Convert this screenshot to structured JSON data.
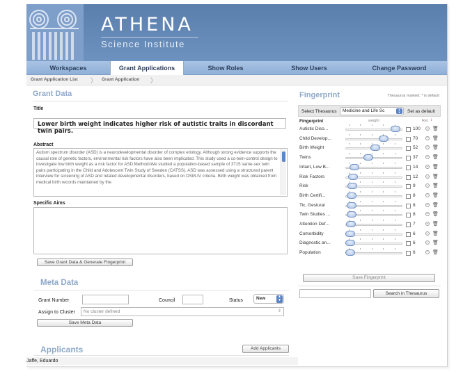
{
  "brand": {
    "title": "ATHENA",
    "subtitle": "Science Institute"
  },
  "nav": {
    "items": [
      {
        "label": "Workspaces"
      },
      {
        "label": "Grant Applications"
      },
      {
        "label": "Show Roles"
      },
      {
        "label": "Show Users"
      },
      {
        "label": "Change Password"
      }
    ]
  },
  "breadcrumb": {
    "items": [
      {
        "label": "Grant Application List"
      },
      {
        "label": "Grant Application"
      }
    ]
  },
  "grant": {
    "section_title": "Grant Data",
    "title_label": "Title",
    "title_value": "Lower birth weight indicates higher risk of autistic traits in discordant twin pairs.",
    "abstract_label": "Abstract",
    "abstract_value": "Autism spectrum disorder (ASD) is a neurodevelopmental disorder of complex etiology. Although strong evidence supports the causal role of genetic factors, environmental risk factors have also been implicated. This study used a co-twin-control design to investigate low birth weight as a risk factor for ASD.MethodsWe studied a population-based sample of 3715 same-sex twin pairs participating in the Child and Adolescent Twin Study of Sweden (CATSS). ASD was assessed using a structured parent interview for screening of ASD and related developmental disorders, based on DSM-IV criteria. Birth weight was obtained from medical birth records maintained by the",
    "specific_aims_label": "Specific Aims",
    "specific_aims_value": "",
    "save_button": "Save Grant Data & Generate Fingerprint"
  },
  "meta": {
    "section_title": "Meta Data",
    "grant_number_label": "Grant Number",
    "grant_number_value": "",
    "council_label": "Council",
    "council_value": "",
    "status_label": "Status",
    "status_value": "New",
    "assign_label": "Assign to Cluster",
    "assign_value": "No cluster defined",
    "save_button": "Save Meta Data"
  },
  "applicants": {
    "section_title": "Applicants",
    "add_button": "Add Applicants",
    "list": [
      "Jaffe, Eduardo"
    ]
  },
  "fingerprint": {
    "section_title": "Fingerprint",
    "note": "Thesaurus marked: * is default",
    "select_label": "Select Thesaurus",
    "select_value": "Medicine and Life Sc",
    "set_default_button": "Set as default",
    "col_term": "Fingerprint",
    "col_weight": "weight",
    "col_rel": "Rel.",
    "rows": [
      {
        "term": "Autistic Diso...",
        "weight": 100,
        "pos": 0.92
      },
      {
        "term": "Child Develop...",
        "weight": 70,
        "pos": 0.68
      },
      {
        "term": "Birth Weight",
        "weight": 52,
        "pos": 0.52
      },
      {
        "term": "Twins",
        "weight": 37,
        "pos": 0.38
      },
      {
        "term": "Infant, Low B...",
        "weight": 14,
        "pos": 0.1
      },
      {
        "term": "Risk Factors",
        "weight": 12,
        "pos": 0.07
      },
      {
        "term": "Risk",
        "weight": 9,
        "pos": 0.05
      },
      {
        "term": "Birth Certifi...",
        "weight": 8,
        "pos": 0.04
      },
      {
        "term": "Tic, Gestural",
        "weight": 8,
        "pos": 0.04
      },
      {
        "term": "Twin Studies ...",
        "weight": 8,
        "pos": 0.04
      },
      {
        "term": "Attention Def...",
        "weight": 7,
        "pos": 0.03
      },
      {
        "term": "Comorbidity",
        "weight": 6,
        "pos": 0.02
      },
      {
        "term": "Diagnostic an...",
        "weight": 6,
        "pos": 0.02
      },
      {
        "term": "Population",
        "weight": 6,
        "pos": 0.02
      }
    ],
    "save_button": "Save Fingerprint",
    "search_value": "",
    "search_button": "Search in Thesaurus"
  },
  "colors": {
    "header": "#6488b6",
    "nav": "#9fbbe0",
    "section": "#8fa9c9",
    "accent": "#5a82c5"
  },
  "icons": {
    "stepper": "stepper-arrows-icon",
    "trash": "trash-icon",
    "remove": "minus-circle-icon",
    "breadcrumb_sep": "chevron-right-icon"
  }
}
